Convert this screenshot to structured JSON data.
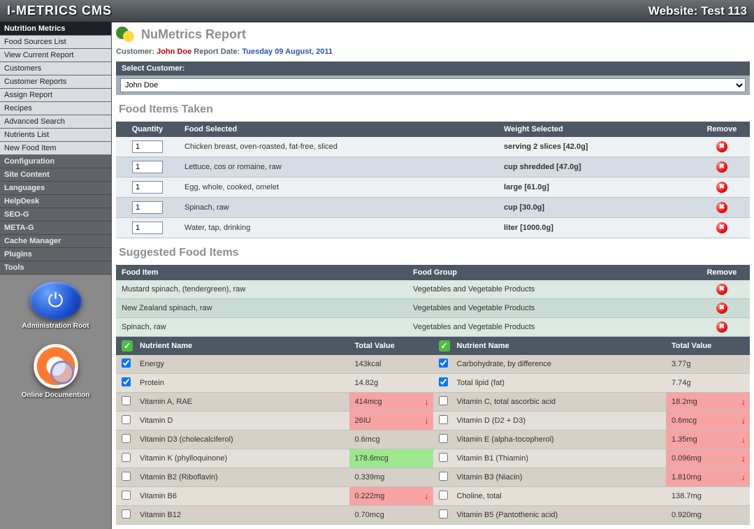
{
  "topbar": {
    "brand": "I-METRICS CMS",
    "website": "Website: Test 113"
  },
  "sidebar": {
    "nutrition_items": [
      "Nutrition Metrics",
      "Food Sources List",
      "View Current Report",
      "Customers",
      "Customer Reports",
      "Assign Report",
      "Recipes",
      "Advanced Search",
      "Nutrients List",
      "New Food Item"
    ],
    "sections": [
      "Configuration",
      "Site Content",
      "Languages",
      "HelpDesk",
      "SEO-G",
      "META-G",
      "Cache Manager",
      "Plugins",
      "Tools"
    ],
    "admin_root_label": "Administration Root",
    "docs_label": "Online Documention"
  },
  "report": {
    "title": "NuMetrics Report",
    "customer_label": "Customer:",
    "customer_name": "John Doe",
    "report_label": "Report Date:",
    "report_date": "Tuesday 09 August, 2011",
    "select_label": "Select Customer:",
    "selected_customer": "John Doe"
  },
  "food_taken": {
    "title": "Food Items Taken",
    "headers": {
      "qty": "Quantity",
      "food": "Food Selected",
      "weight": "Weight Selected",
      "remove": "Remove"
    },
    "rows": [
      {
        "qty": "1",
        "food": "Chicken breast, oven-roasted, fat-free, sliced",
        "weight": "serving 2 slices [42.0g]"
      },
      {
        "qty": "1",
        "food": "Lettuce, cos or romaine, raw",
        "weight": "cup shredded [47.0g]"
      },
      {
        "qty": "1",
        "food": "Egg, whole, cooked, omelet",
        "weight": "large [61.0g]"
      },
      {
        "qty": "1",
        "food": "Spinach, raw",
        "weight": "cup [30.0g]"
      },
      {
        "qty": "1",
        "food": "Water, tap, drinking",
        "weight": "liter [1000.0g]"
      }
    ]
  },
  "suggested": {
    "title": "Suggested Food Items",
    "headers": {
      "item": "Food Item",
      "group": "Food Group",
      "remove": "Remove"
    },
    "rows": [
      {
        "item": "Mustard spinach, (tendergreen), raw",
        "group": "Vegetables and Vegetable Products"
      },
      {
        "item": "New Zealand spinach, raw",
        "group": "Vegetables and Vegetable Products"
      },
      {
        "item": "Spinach, raw",
        "group": "Vegetables and Vegetable Products"
      }
    ]
  },
  "nutrients": {
    "headers": {
      "name": "Nutrient Name",
      "value": "Total Value"
    },
    "left": [
      {
        "chk": true,
        "name": "Energy",
        "val": "143kcal",
        "cls": ""
      },
      {
        "chk": true,
        "name": "Protein",
        "val": "14.82g",
        "cls": ""
      },
      {
        "chk": false,
        "name": "Vitamin A, RAE",
        "val": "414mcg",
        "cls": "red",
        "arrow": true
      },
      {
        "chk": false,
        "name": "Vitamin D",
        "val": "26IU",
        "cls": "red",
        "arrow": true
      },
      {
        "chk": false,
        "name": "Vitamin D3 (cholecalciferol)",
        "val": "0.6mcg",
        "cls": ""
      },
      {
        "chk": false,
        "name": "Vitamin K (phylloquinone)",
        "val": "178.6mcg",
        "cls": "green"
      },
      {
        "chk": false,
        "name": "Vitamin B2 (Riboflavin)",
        "val": "0.339mg",
        "cls": ""
      },
      {
        "chk": false,
        "name": "Vitamin B6",
        "val": "0.222mg",
        "cls": "red",
        "arrow": true
      },
      {
        "chk": false,
        "name": "Vitamin B12",
        "val": "0.70mcg",
        "cls": ""
      }
    ],
    "right": [
      {
        "chk": true,
        "name": "Carbohydrate, by difference",
        "val": "3.77g",
        "cls": ""
      },
      {
        "chk": true,
        "name": "Total lipid (fat)",
        "val": "7.74g",
        "cls": ""
      },
      {
        "chk": false,
        "name": "Vitamin C, total ascorbic acid",
        "val": "18.2mg",
        "cls": "red",
        "arrow": true
      },
      {
        "chk": false,
        "name": "Vitamin D (D2 + D3)",
        "val": "0.6mcg",
        "cls": "red",
        "arrow": true
      },
      {
        "chk": false,
        "name": "Vitamin E (alpha-tocopherol)",
        "val": "1.35mg",
        "cls": "red",
        "arrow": true
      },
      {
        "chk": false,
        "name": "Vitamin B1 (Thiamin)",
        "val": "0.096mg",
        "cls": "red",
        "arrow": true
      },
      {
        "chk": false,
        "name": "Vitamin B3 (Niacin)",
        "val": "1.810mg",
        "cls": "red",
        "arrow": true
      },
      {
        "chk": false,
        "name": "Choline, total",
        "val": "138.7mg",
        "cls": ""
      },
      {
        "chk": false,
        "name": "Vitamin B5 (Pantothenic acid)",
        "val": "0.920mg",
        "cls": ""
      }
    ]
  }
}
